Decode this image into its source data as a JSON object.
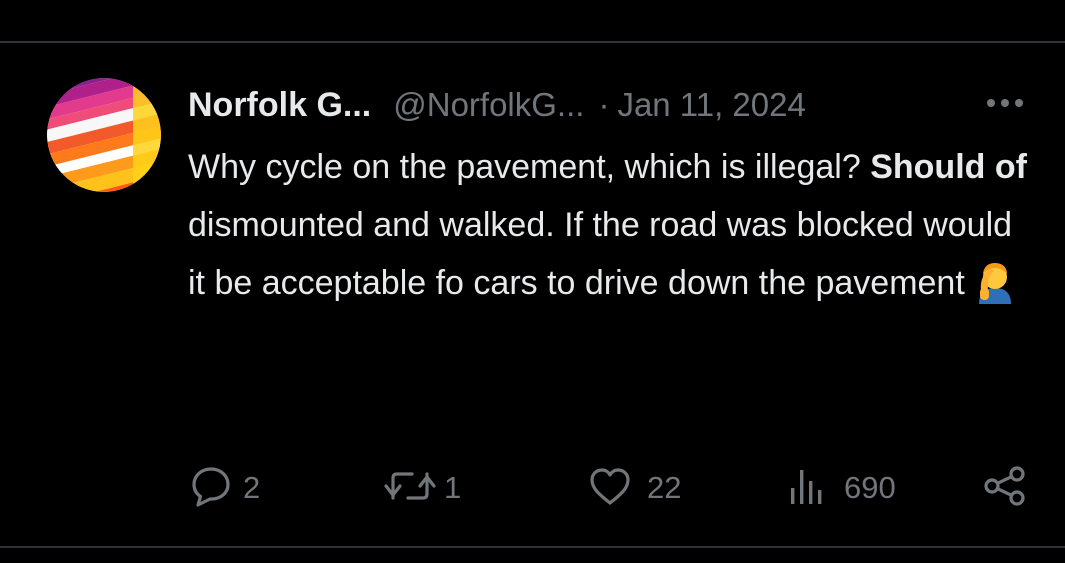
{
  "tweet": {
    "author": {
      "display_name": "Norfolk G...",
      "handle": "@NorfolkG..."
    },
    "separator": "·",
    "date": "Jan 11, 2024",
    "text": {
      "part1": "Why cycle on the pavement, which is illegal? ",
      "bold": "Should of",
      "part2": " dismounted and walked. If the road was blocked would it be acceptable fo cars to drive down the pavement"
    },
    "emoji": "man-facepalming-emoji",
    "stats": {
      "replies": "2",
      "reposts": "1",
      "likes": "22",
      "views": "690"
    }
  },
  "icons": {
    "more": "more-horizontal-icon",
    "reply": "reply-bubble-icon",
    "repost": "repost-arrows-icon",
    "like": "heart-icon",
    "views": "views-bar-chart-icon",
    "share": "share-nodes-icon"
  },
  "colors": {
    "background": "#000000",
    "text_primary": "#e7e9ea",
    "text_secondary": "#71767b",
    "divider": "#2f3336"
  }
}
